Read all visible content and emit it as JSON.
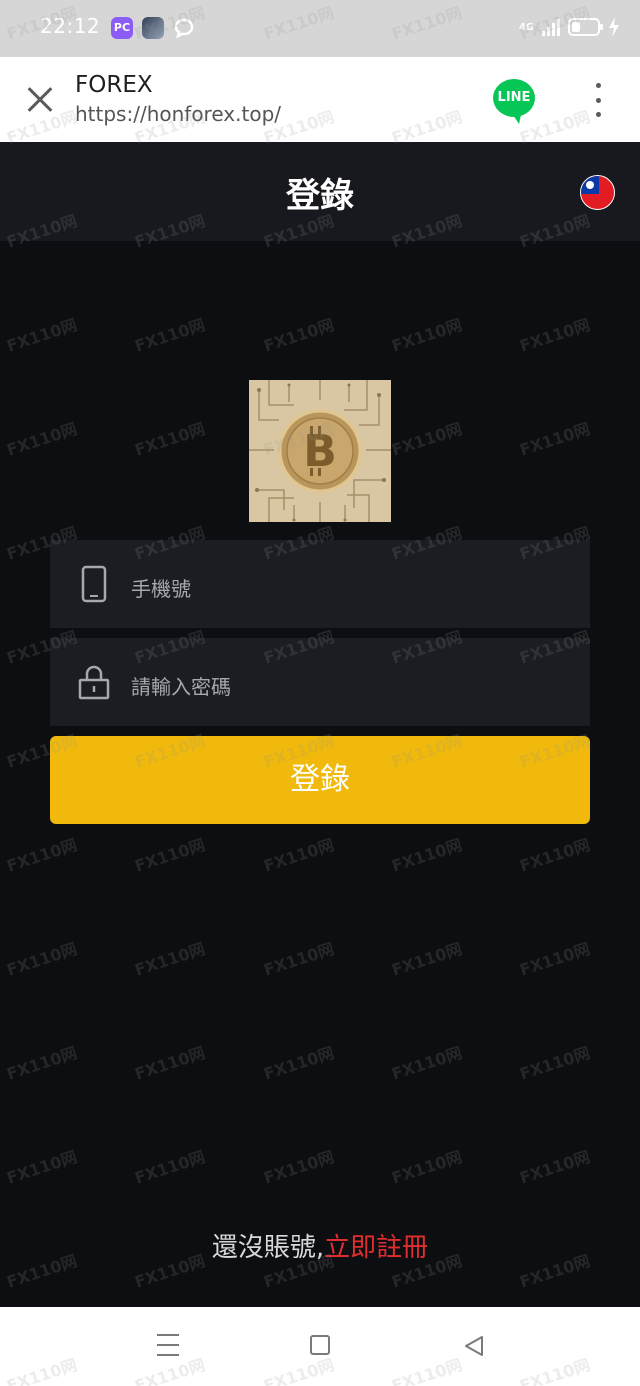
{
  "status_bar": {
    "time": "22:12",
    "network": "4G",
    "apps": [
      "pc-app-icon",
      "game-app-icon",
      "chat-app-icon"
    ]
  },
  "browser": {
    "title": "FOREX",
    "url": "https://honforex.top/",
    "line_label": "LINE"
  },
  "header": {
    "title": "登錄",
    "language_flag": "taiwan-flag-icon"
  },
  "form": {
    "phone_placeholder": "手機號",
    "password_placeholder": "請輸入密碼",
    "login_label": "登錄"
  },
  "footer": {
    "question": "還沒賬號,",
    "register_link": "立即註冊"
  },
  "watermark": "FX110网",
  "colors": {
    "accent": "#f0b90b",
    "background": "#0c0e12",
    "field": "#1b1d22",
    "link": "#e02e2e"
  }
}
